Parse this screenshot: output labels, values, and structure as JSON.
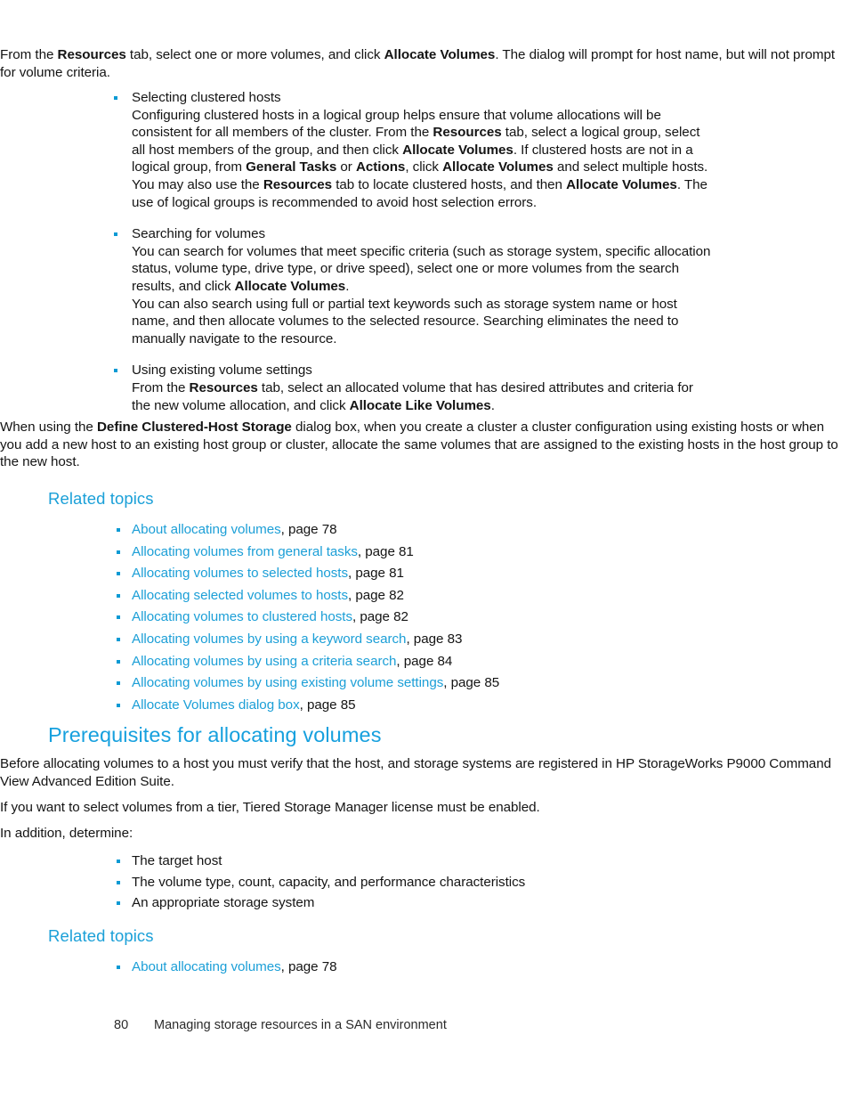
{
  "document": {
    "footer": {
      "page_number": "80",
      "running_title": "Managing storage resources in a SAN environment"
    },
    "colors": {
      "heading_blue": "#16a0de",
      "related_topics_blue": "#1ba0d8",
      "link_blue": "#1c9fd7",
      "bullet_blue": "#0b9ad4",
      "body_text": "#141414"
    }
  },
  "intro_paragraph": {
    "part1": "From the ",
    "bold1": "Resources",
    "part2": " tab, select one or more volumes, and click ",
    "bold2": "Allocate Volumes",
    "part3": ". The dialog will prompt for host name, but will not prompt for volume criteria."
  },
  "bullets": [
    {
      "title": "Selecting clustered hosts",
      "paragraphs": [
        {
          "segments": [
            {
              "text": "Configuring clustered hosts in a logical group helps ensure that volume allocations will be consistent for all members of the cluster. From the ",
              "bold": false
            },
            {
              "text": "Resources",
              "bold": true
            },
            {
              "text": " tab, select a logical group, select all host members of the group, and then click ",
              "bold": false
            },
            {
              "text": "Allocate Volumes",
              "bold": true
            },
            {
              "text": ". If clustered hosts are not in a logical group, from ",
              "bold": false
            },
            {
              "text": "General Tasks",
              "bold": true
            },
            {
              "text": " or ",
              "bold": false
            },
            {
              "text": "Actions",
              "bold": true
            },
            {
              "text": ", click ",
              "bold": false
            },
            {
              "text": "Allocate Volumes",
              "bold": true
            },
            {
              "text": " and select multiple hosts. You may also use the ",
              "bold": false
            },
            {
              "text": "Resources",
              "bold": true
            },
            {
              "text": " tab to locate clustered hosts, and then ",
              "bold": false
            },
            {
              "text": "Allocate Volumes",
              "bold": true
            },
            {
              "text": ". The use of logical groups is recommended to avoid host selection errors.",
              "bold": false
            }
          ]
        }
      ]
    },
    {
      "title": "Searching for volumes",
      "paragraphs": [
        {
          "segments": [
            {
              "text": "You can search for volumes that meet specific criteria (such as storage system, specific allocation status, volume type, drive type, or drive speed), select one or more volumes from the search results, and click ",
              "bold": false
            },
            {
              "text": "Allocate Volumes",
              "bold": true
            },
            {
              "text": ".",
              "bold": false
            }
          ]
        },
        {
          "segments": [
            {
              "text": "You can also search using full or partial text keywords such as storage system name or host name, and then allocate volumes to the selected resource. Searching eliminates the need to manually navigate to the resource.",
              "bold": false
            }
          ]
        }
      ]
    },
    {
      "title": "Using existing volume settings",
      "paragraphs": [
        {
          "segments": [
            {
              "text": "From the ",
              "bold": false
            },
            {
              "text": "Resources",
              "bold": true
            },
            {
              "text": " tab, select an allocated volume that has desired attributes and criteria for the new volume allocation, and click ",
              "bold": false
            },
            {
              "text": "Allocate Like Volumes",
              "bold": true
            },
            {
              "text": ".",
              "bold": false
            }
          ]
        }
      ]
    }
  ],
  "closing_paragraph": {
    "segments": [
      {
        "text": "When using the ",
        "bold": false
      },
      {
        "text": "Define Clustered-Host Storage",
        "bold": true
      },
      {
        "text": " dialog box, when you create a cluster a cluster configuration using existing hosts or when you add a new host to an existing host group or cluster, allocate the same volumes that are assigned to the existing hosts in the host group to the new host.",
        "bold": false
      }
    ]
  },
  "related_topics_1": {
    "heading": "Related topics",
    "items": [
      {
        "link": "About allocating volumes",
        "pageref": ", page 78"
      },
      {
        "link": "Allocating volumes from general tasks",
        "pageref": ", page 81"
      },
      {
        "link": "Allocating volumes to selected hosts",
        "pageref": ", page 81"
      },
      {
        "link": "Allocating selected volumes to hosts",
        "pageref": ", page 82"
      },
      {
        "link": "Allocating volumes to clustered hosts",
        "pageref": ", page 82"
      },
      {
        "link": "Allocating volumes by using a keyword search",
        "pageref": ", page 83"
      },
      {
        "link": "Allocating volumes by using a criteria search",
        "pageref": ", page 84"
      },
      {
        "link": "Allocating volumes by using existing volume settings",
        "pageref": ", page 85"
      },
      {
        "link": "Allocate Volumes dialog box",
        "pageref": ", page 85"
      }
    ]
  },
  "prerequisites_section": {
    "heading": "Prerequisites for allocating volumes",
    "paragraph_1": "Before allocating volumes to a host you must verify that the host, and storage systems are registered in HP StorageWorks P9000 Command View Advanced Edition Suite.",
    "paragraph_2": "If you want to select volumes from a tier, Tiered Storage Manager license must be enabled.",
    "paragraph_3": "In addition, determine:",
    "items": [
      "The target host",
      "The volume type, count, capacity, and performance characteristics",
      "An appropriate storage system"
    ]
  },
  "related_topics_2": {
    "heading": "Related topics",
    "items": [
      {
        "link": "About allocating volumes",
        "pageref": ", page 78"
      }
    ]
  }
}
